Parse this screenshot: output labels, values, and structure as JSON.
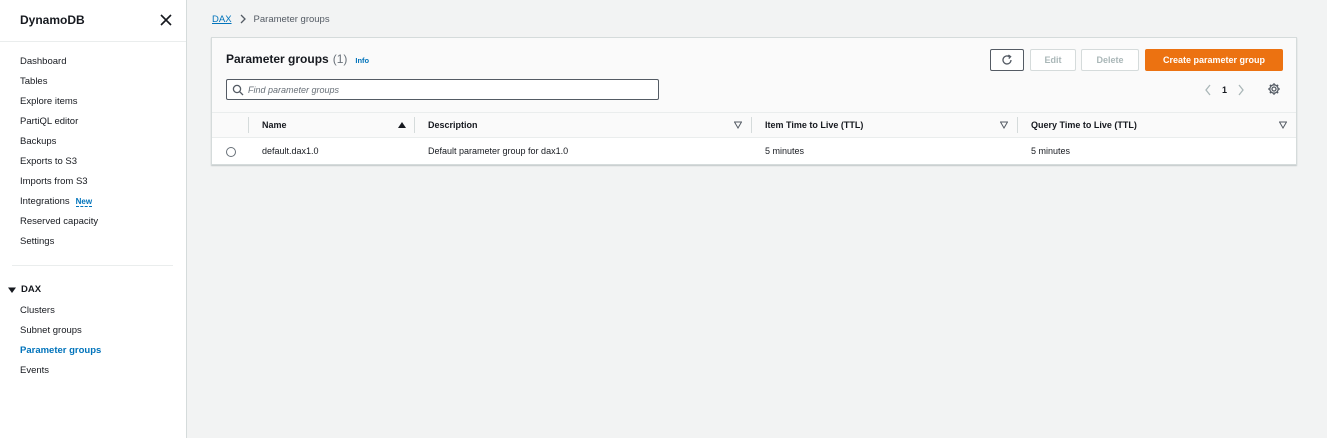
{
  "sidebar": {
    "title": "DynamoDB",
    "items": [
      {
        "label": "Dashboard"
      },
      {
        "label": "Tables"
      },
      {
        "label": "Explore items"
      },
      {
        "label": "PartiQL editor"
      },
      {
        "label": "Backups"
      },
      {
        "label": "Exports to S3"
      },
      {
        "label": "Imports from S3"
      },
      {
        "label": "Integrations",
        "badge": "New"
      },
      {
        "label": "Reserved capacity"
      },
      {
        "label": "Settings"
      }
    ],
    "dax": {
      "title": "DAX",
      "items": [
        {
          "label": "Clusters"
        },
        {
          "label": "Subnet groups"
        },
        {
          "label": "Parameter groups",
          "active": true
        },
        {
          "label": "Events"
        }
      ]
    }
  },
  "breadcrumb": {
    "parent": "DAX",
    "current": "Parameter groups"
  },
  "panel": {
    "title": "Parameter groups",
    "count": "(1)",
    "info": "Info",
    "buttons": {
      "edit": "Edit",
      "delete": "Delete",
      "create": "Create parameter group"
    },
    "search": {
      "placeholder": "Find parameter groups",
      "value": ""
    },
    "pagination": {
      "current_page": "1"
    }
  },
  "table": {
    "columns": [
      "Name",
      "Description",
      "Item Time to Live (TTL)",
      "Query Time to Live (TTL)"
    ],
    "rows": [
      {
        "name": "default.dax1.0",
        "description": "Default parameter group for dax1.0",
        "item_ttl": "5 minutes",
        "query_ttl": "5 minutes"
      }
    ]
  },
  "colors": {
    "primary_button": "#ec7211",
    "link": "#0073bb",
    "background": "#f2f3f3"
  },
  "icons": [
    "close-icon",
    "chevron-right-icon",
    "caret-down-icon",
    "refresh-icon",
    "search-icon",
    "chevron-left-icon",
    "gear-icon",
    "sort-ascending-icon",
    "sort-descending-icon"
  ]
}
